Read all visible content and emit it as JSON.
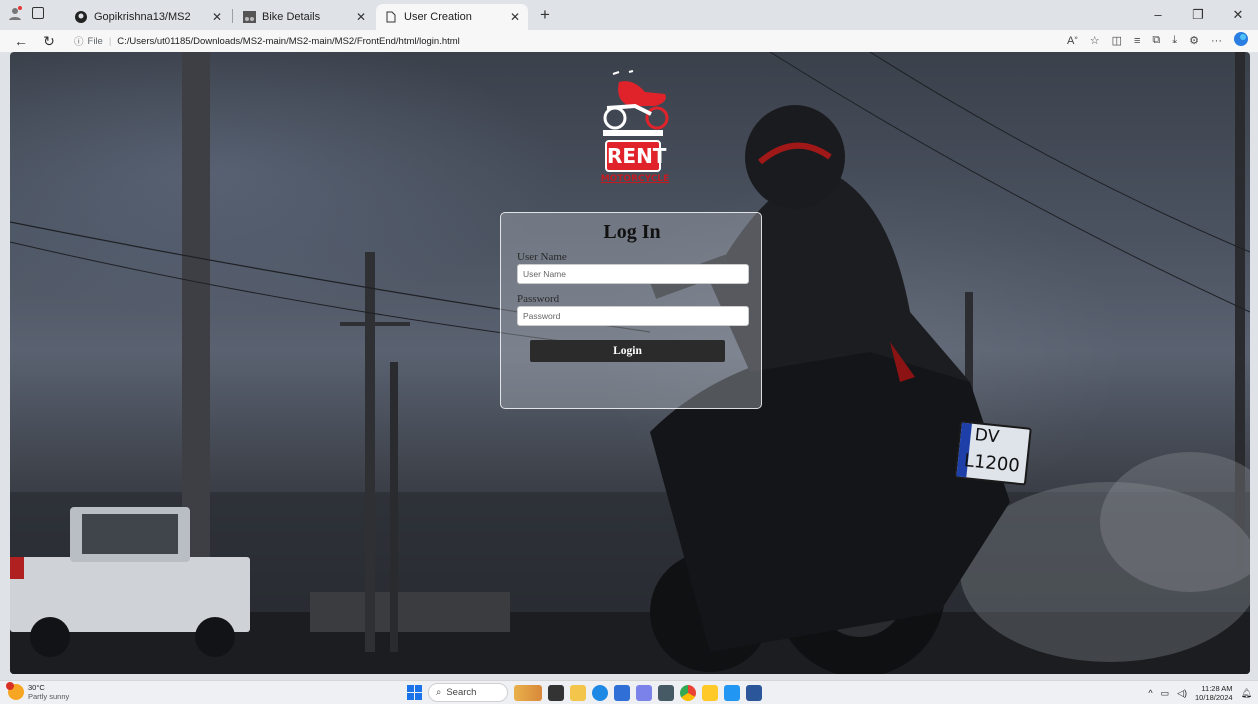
{
  "browser": {
    "tabs": [
      {
        "title": "Gopikrishna13/MS2",
        "icon": "github-icon"
      },
      {
        "title": "Bike Details",
        "icon": "bike-thumbnail-icon"
      },
      {
        "title": "User Creation",
        "icon": "page-icon",
        "active": true
      }
    ],
    "url": {
      "scheme_label": "File",
      "path": "C:/Users/ut01185/Downloads/MS2-main/MS2-main/MS2/FrontEnd/html/login.html"
    }
  },
  "logo": {
    "word1": "RENT",
    "word2": "MOTORCYCLE",
    "color": "#e0232a"
  },
  "login": {
    "title": "Log In",
    "username_label": "User Name",
    "username_placeholder": "User Name",
    "password_label": "Password",
    "password_placeholder": "Password",
    "submit_label": "Login"
  },
  "plate": {
    "line1": "DV",
    "line2": "L1200"
  },
  "taskbar": {
    "weather": {
      "temp": "30°C",
      "condition": "Partly sunny"
    },
    "search_label": "Search",
    "clock": {
      "time": "11:28 AM",
      "date": "10/18/2024"
    }
  }
}
